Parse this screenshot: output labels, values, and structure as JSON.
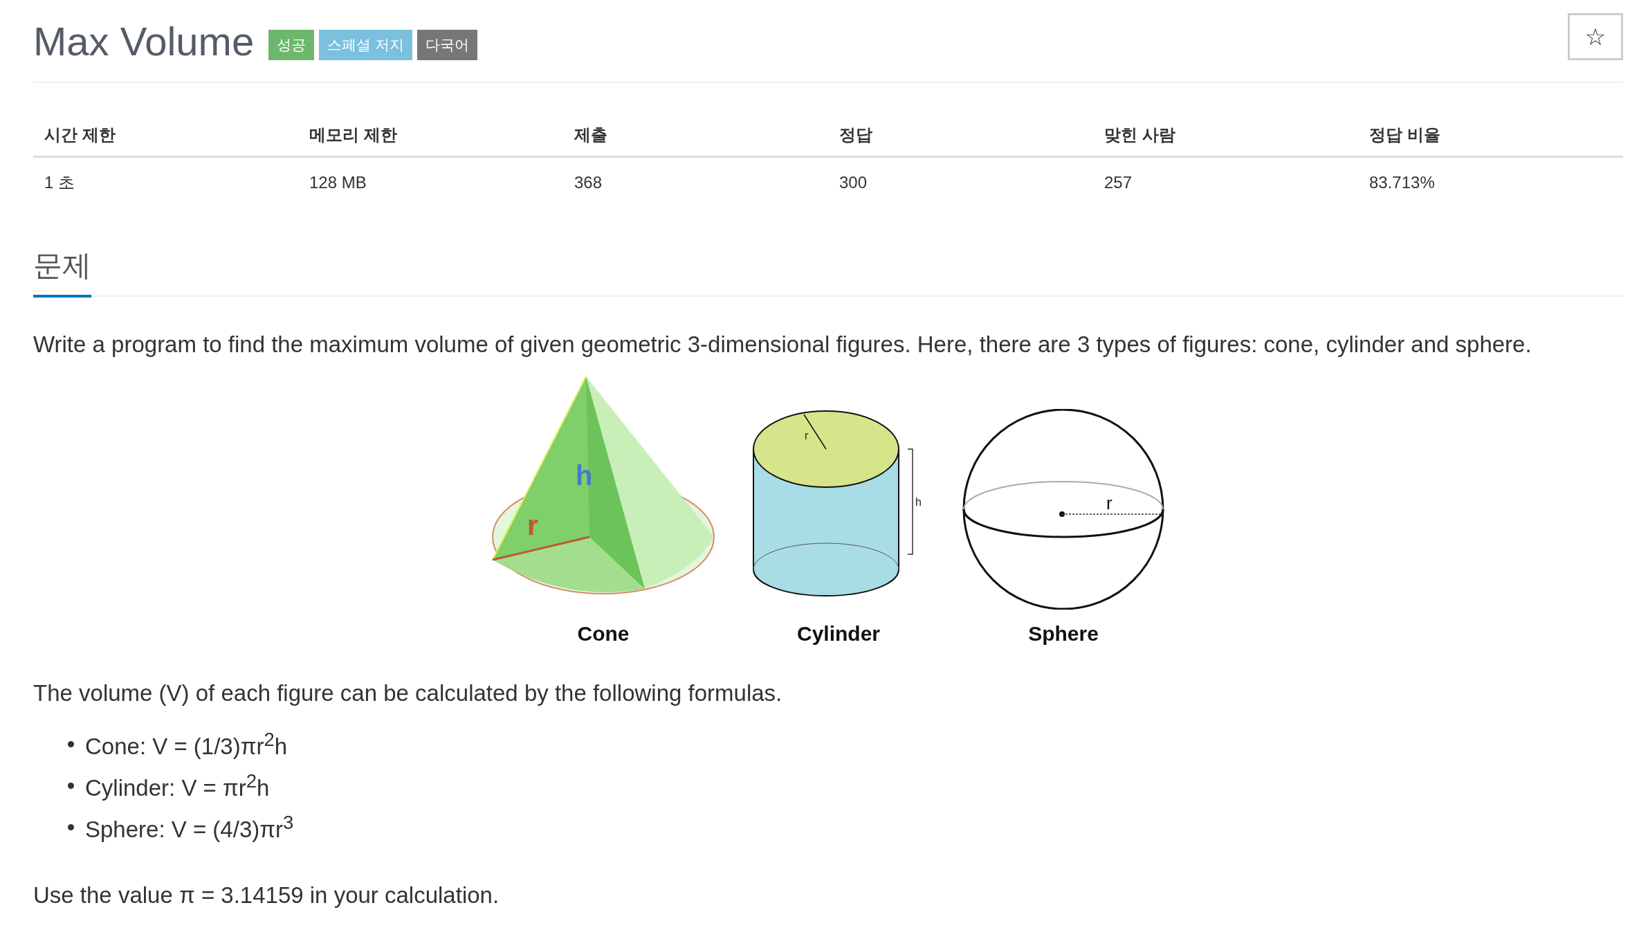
{
  "title": "Max Volume",
  "badges": [
    {
      "label": "성공",
      "color": "#6db76d"
    },
    {
      "label": "스페셜 저지",
      "color": "#7bc0de"
    },
    {
      "label": "다국어",
      "color": "#777777"
    }
  ],
  "star_button": {
    "label": "☆"
  },
  "stats": {
    "columns": [
      "시간 제한",
      "메모리 제한",
      "제출",
      "정답",
      "맞힌 사람",
      "정답 비율"
    ],
    "row": [
      "1 초",
      "128 MB",
      "368",
      "300",
      "257",
      "83.713%"
    ]
  },
  "section": {
    "title": "문제"
  },
  "intro": "Write a program to find the maximum volume of given geometric 3-dimensional figures. Here, there are 3 types of figures: cone, cylinder and sphere.",
  "figures": [
    {
      "kind": "cone",
      "label": "Cone",
      "marks": [
        "h",
        "r"
      ]
    },
    {
      "kind": "cylinder",
      "label": "Cylinder",
      "marks": [
        "r",
        "h"
      ]
    },
    {
      "kind": "sphere",
      "label": "Sphere",
      "marks": [
        "r"
      ]
    }
  ],
  "formulas_intro": "The volume (V) of each figure can be calculated by the following formulas.",
  "formulas": [
    "Cone: V = (1/3)πr$^{2}$h",
    "Cylinder: V = πr$^{2}$h",
    "Sphere: V = (4/3)πr$^{3}$"
  ],
  "note": "Use the value π = 3.14159 in your calculation."
}
